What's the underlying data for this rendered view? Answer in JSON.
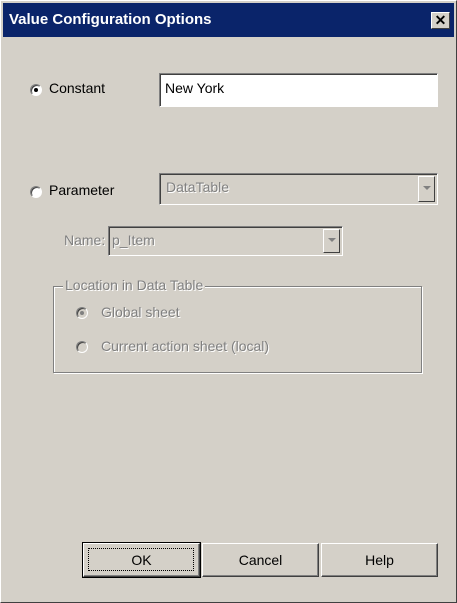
{
  "window": {
    "title": "Value Configuration Options",
    "close_glyph": "✕"
  },
  "constant": {
    "label": "Constant",
    "selected": true,
    "value": "New York"
  },
  "parameter": {
    "label": "Parameter",
    "selected": false,
    "type_value": "DataTable",
    "name_label": "Name:",
    "name_value": "p_Item"
  },
  "location": {
    "title": "Location in Data Table",
    "options": [
      {
        "label": "Global sheet",
        "selected": true
      },
      {
        "label": "Current action sheet (local)",
        "selected": false
      }
    ]
  },
  "buttons": {
    "ok": "OK",
    "cancel": "Cancel",
    "help": "Help"
  },
  "icons": {
    "close": "close-icon",
    "dropdown": "chevron-down-icon"
  },
  "colors": {
    "titlebar": "#0a246a",
    "dialog_face": "#d4d0c8",
    "disabled_text": "#808080"
  }
}
